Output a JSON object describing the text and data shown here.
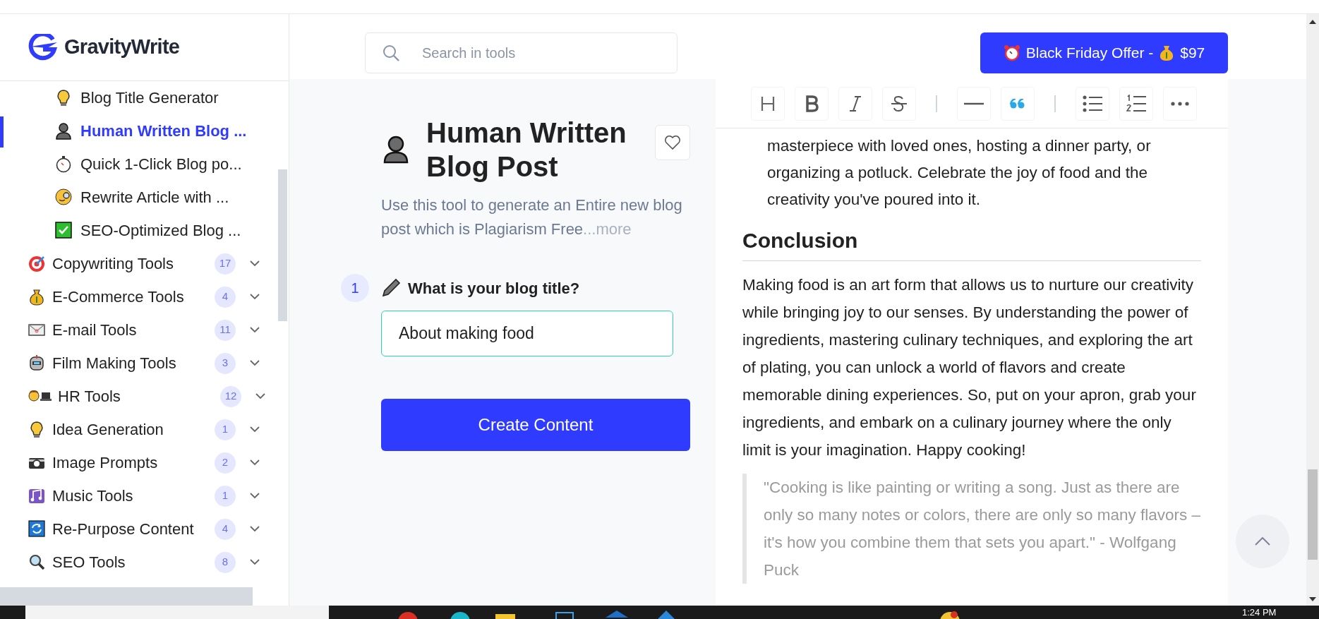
{
  "logo": {
    "name": "GravityWrite"
  },
  "sidebar": {
    "items": [
      {
        "kind": "tool",
        "label": "Blog Title Generator",
        "selected": false
      },
      {
        "kind": "tool",
        "label": "Human Written Blog ...",
        "selected": true
      },
      {
        "kind": "tool",
        "label": "Quick 1-Click Blog po...",
        "selected": false
      },
      {
        "kind": "tool",
        "label": "Rewrite Article with ...",
        "selected": false
      },
      {
        "kind": "tool",
        "label": "SEO-Optimized Blog ...",
        "selected": false
      },
      {
        "kind": "category",
        "label": "Copywriting Tools",
        "count": "17",
        "expanded": false
      },
      {
        "kind": "category",
        "label": "E-Commerce Tools",
        "count": "4",
        "expanded": false
      },
      {
        "kind": "category",
        "label": "E-mail Tools",
        "count": "11",
        "expanded": false
      },
      {
        "kind": "category",
        "label": "Film Making Tools",
        "count": "3",
        "expanded": false
      },
      {
        "kind": "category",
        "label": "HR Tools",
        "count": "12",
        "expanded": false
      },
      {
        "kind": "category",
        "label": "Idea Generation",
        "count": "1",
        "expanded": false
      },
      {
        "kind": "category",
        "label": "Image Prompts",
        "count": "2",
        "expanded": false
      },
      {
        "kind": "category",
        "label": "Music Tools",
        "count": "1",
        "expanded": false
      },
      {
        "kind": "category",
        "label": "Re-Purpose Content",
        "count": "4",
        "expanded": false
      },
      {
        "kind": "category",
        "label": "SEO Tools",
        "count": "8",
        "expanded": false
      }
    ]
  },
  "search": {
    "placeholder": "Search in tools"
  },
  "offer_button": {
    "label": "Black Friday Offer -",
    "price": "$97"
  },
  "tool": {
    "title": "Human Written Blog Post",
    "favorite": false,
    "description": "Use this tool to generate an Entire new blog post which is Plagiarism Free",
    "more": "...more"
  },
  "steps": [
    {
      "number": "1",
      "label": "What is your blog title?",
      "value": "About making food"
    }
  ],
  "create_button": "Create Content",
  "editor": {
    "blocks": [
      {
        "kind": "list_item",
        "text": "masterpiece with loved ones, hosting a dinner party, or organizing a potluck. Celebrate the joy of food and the creativity you've poured into it."
      },
      {
        "kind": "heading",
        "text": "Conclusion"
      },
      {
        "kind": "paragraph",
        "text": "Making food is an art form that allows us to nurture our creativity while bringing joy to our senses. By understanding the power of ingredients, mastering culinary techniques, and exploring the art of plating, you can unlock a world of flavors and create memorable dining experiences. So, put on your apron, grab your ingredients, and embark on a culinary journey where the only limit is your imagination. Happy cooking!"
      },
      {
        "kind": "quote",
        "text": "\"Cooking is like painting or writing a song. Just as there are only so many notes or colors, there are only so many flavors – it's how you combine them that sets you apart.\" - Wolfgang Puck"
      }
    ]
  },
  "taskbar": {
    "time": "1:24 PM"
  }
}
